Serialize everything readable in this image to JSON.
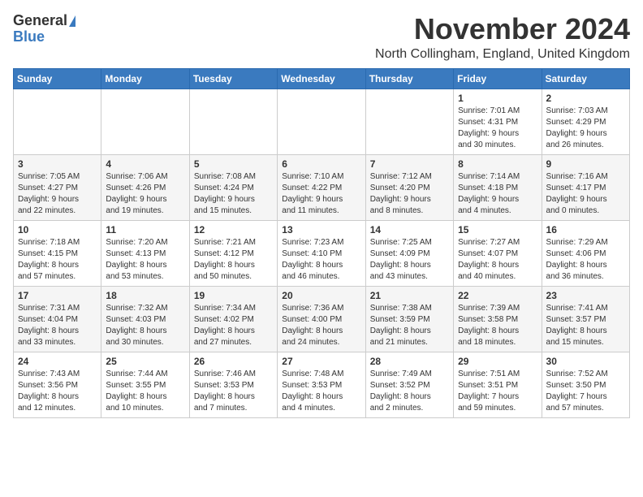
{
  "logo": {
    "line1": "General",
    "line2": "Blue"
  },
  "title": "November 2024",
  "location": "North Collingham, England, United Kingdom",
  "weekdays": [
    "Sunday",
    "Monday",
    "Tuesday",
    "Wednesday",
    "Thursday",
    "Friday",
    "Saturday"
  ],
  "weeks": [
    [
      {
        "day": "",
        "info": ""
      },
      {
        "day": "",
        "info": ""
      },
      {
        "day": "",
        "info": ""
      },
      {
        "day": "",
        "info": ""
      },
      {
        "day": "",
        "info": ""
      },
      {
        "day": "1",
        "info": "Sunrise: 7:01 AM\nSunset: 4:31 PM\nDaylight: 9 hours\nand 30 minutes."
      },
      {
        "day": "2",
        "info": "Sunrise: 7:03 AM\nSunset: 4:29 PM\nDaylight: 9 hours\nand 26 minutes."
      }
    ],
    [
      {
        "day": "3",
        "info": "Sunrise: 7:05 AM\nSunset: 4:27 PM\nDaylight: 9 hours\nand 22 minutes."
      },
      {
        "day": "4",
        "info": "Sunrise: 7:06 AM\nSunset: 4:26 PM\nDaylight: 9 hours\nand 19 minutes."
      },
      {
        "day": "5",
        "info": "Sunrise: 7:08 AM\nSunset: 4:24 PM\nDaylight: 9 hours\nand 15 minutes."
      },
      {
        "day": "6",
        "info": "Sunrise: 7:10 AM\nSunset: 4:22 PM\nDaylight: 9 hours\nand 11 minutes."
      },
      {
        "day": "7",
        "info": "Sunrise: 7:12 AM\nSunset: 4:20 PM\nDaylight: 9 hours\nand 8 minutes."
      },
      {
        "day": "8",
        "info": "Sunrise: 7:14 AM\nSunset: 4:18 PM\nDaylight: 9 hours\nand 4 minutes."
      },
      {
        "day": "9",
        "info": "Sunrise: 7:16 AM\nSunset: 4:17 PM\nDaylight: 9 hours\nand 0 minutes."
      }
    ],
    [
      {
        "day": "10",
        "info": "Sunrise: 7:18 AM\nSunset: 4:15 PM\nDaylight: 8 hours\nand 57 minutes."
      },
      {
        "day": "11",
        "info": "Sunrise: 7:20 AM\nSunset: 4:13 PM\nDaylight: 8 hours\nand 53 minutes."
      },
      {
        "day": "12",
        "info": "Sunrise: 7:21 AM\nSunset: 4:12 PM\nDaylight: 8 hours\nand 50 minutes."
      },
      {
        "day": "13",
        "info": "Sunrise: 7:23 AM\nSunset: 4:10 PM\nDaylight: 8 hours\nand 46 minutes."
      },
      {
        "day": "14",
        "info": "Sunrise: 7:25 AM\nSunset: 4:09 PM\nDaylight: 8 hours\nand 43 minutes."
      },
      {
        "day": "15",
        "info": "Sunrise: 7:27 AM\nSunset: 4:07 PM\nDaylight: 8 hours\nand 40 minutes."
      },
      {
        "day": "16",
        "info": "Sunrise: 7:29 AM\nSunset: 4:06 PM\nDaylight: 8 hours\nand 36 minutes."
      }
    ],
    [
      {
        "day": "17",
        "info": "Sunrise: 7:31 AM\nSunset: 4:04 PM\nDaylight: 8 hours\nand 33 minutes."
      },
      {
        "day": "18",
        "info": "Sunrise: 7:32 AM\nSunset: 4:03 PM\nDaylight: 8 hours\nand 30 minutes."
      },
      {
        "day": "19",
        "info": "Sunrise: 7:34 AM\nSunset: 4:02 PM\nDaylight: 8 hours\nand 27 minutes."
      },
      {
        "day": "20",
        "info": "Sunrise: 7:36 AM\nSunset: 4:00 PM\nDaylight: 8 hours\nand 24 minutes."
      },
      {
        "day": "21",
        "info": "Sunrise: 7:38 AM\nSunset: 3:59 PM\nDaylight: 8 hours\nand 21 minutes."
      },
      {
        "day": "22",
        "info": "Sunrise: 7:39 AM\nSunset: 3:58 PM\nDaylight: 8 hours\nand 18 minutes."
      },
      {
        "day": "23",
        "info": "Sunrise: 7:41 AM\nSunset: 3:57 PM\nDaylight: 8 hours\nand 15 minutes."
      }
    ],
    [
      {
        "day": "24",
        "info": "Sunrise: 7:43 AM\nSunset: 3:56 PM\nDaylight: 8 hours\nand 12 minutes."
      },
      {
        "day": "25",
        "info": "Sunrise: 7:44 AM\nSunset: 3:55 PM\nDaylight: 8 hours\nand 10 minutes."
      },
      {
        "day": "26",
        "info": "Sunrise: 7:46 AM\nSunset: 3:53 PM\nDaylight: 8 hours\nand 7 minutes."
      },
      {
        "day": "27",
        "info": "Sunrise: 7:48 AM\nSunset: 3:53 PM\nDaylight: 8 hours\nand 4 minutes."
      },
      {
        "day": "28",
        "info": "Sunrise: 7:49 AM\nSunset: 3:52 PM\nDaylight: 8 hours\nand 2 minutes."
      },
      {
        "day": "29",
        "info": "Sunrise: 7:51 AM\nSunset: 3:51 PM\nDaylight: 7 hours\nand 59 minutes."
      },
      {
        "day": "30",
        "info": "Sunrise: 7:52 AM\nSunset: 3:50 PM\nDaylight: 7 hours\nand 57 minutes."
      }
    ]
  ]
}
